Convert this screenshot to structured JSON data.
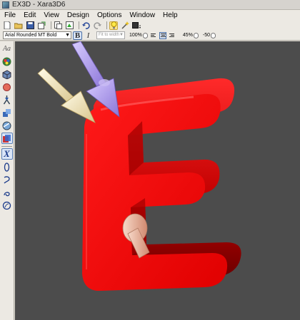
{
  "window": {
    "title": "EX3D - Xara3D6"
  },
  "menu": [
    "File",
    "Edit",
    "View",
    "Design",
    "Options",
    "Window",
    "Help"
  ],
  "toolbar": {
    "icons": [
      "new-icon",
      "open-icon",
      "save-icon",
      "export-icon",
      "import-icon",
      "save-animation-icon",
      "undo-icon",
      "redo-icon",
      "lighting-icon",
      "magic-wand-icon",
      "render-icon"
    ]
  },
  "format_bar": {
    "font": "Arial Rounded MT Bold",
    "bold": "B",
    "italic": "I",
    "fit_placeholder": "Fit to width",
    "scale": "100%",
    "line_spacing": "45%",
    "char_spacing": "-50"
  },
  "sidebar": {
    "icons": [
      "text-tool-icon",
      "color-tool-icon",
      "texture-tool-icon",
      "shadow-tool-icon",
      "lights-tool-icon",
      "shape-tool-icon",
      "view-tool-icon",
      "extrude-tool-icon",
      "rotate-x-icon",
      "rotate-y-icon",
      "rotate-z-icon",
      "animation-icon",
      "options-icon"
    ],
    "text_tool_label": "Aa"
  },
  "colors": {
    "canvas_bg": "#4c4c4c",
    "letter_red": "#ff0000",
    "light_cream": "#f7e9c2",
    "light_lavender": "#b9a6f0",
    "light_peach": "#f2c6b0"
  }
}
